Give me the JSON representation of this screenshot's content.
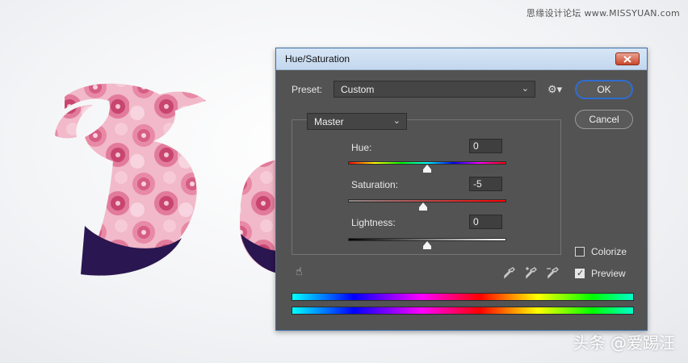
{
  "watermark": "思缘设计论坛 www.MISSYUAN.com",
  "bottom_watermark": "头条 @爱踢汪",
  "dialog": {
    "title": "Hue/Saturation",
    "preset_label": "Preset:",
    "preset_value": "Custom",
    "channel_value": "Master",
    "ok_label": "OK",
    "cancel_label": "Cancel",
    "hue": {
      "label": "Hue:",
      "value": "0",
      "level": 0.5
    },
    "saturation": {
      "label": "Saturation:",
      "value": "-5",
      "level": 0.475
    },
    "lightness": {
      "label": "Lightness:",
      "value": "0",
      "level": 0.5
    },
    "colorize": {
      "label": "Colorize",
      "checked": false
    },
    "preview": {
      "label": "Preview",
      "checked": true
    }
  },
  "colors": {
    "dialog_bg": "#535353",
    "title_bar": "#c9dbef",
    "ok_outline": "#2f6dd0",
    "text_dark_navy": "#2a1650",
    "flower_pink": "#e07a9a"
  },
  "icons": [
    "close-icon",
    "gear-icon",
    "hand-icon",
    "eyedropper-icon",
    "eyedropper-plus-icon",
    "eyedropper-minus-icon",
    "chevron-down-icon"
  ]
}
